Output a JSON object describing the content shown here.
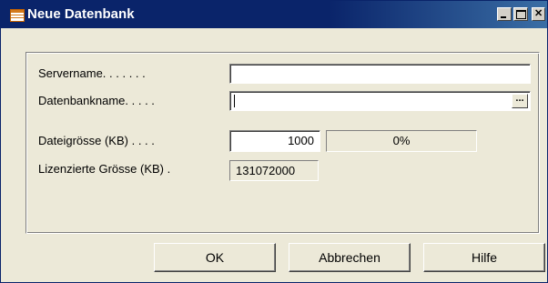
{
  "window": {
    "title": "Neue Datenbank",
    "icon": "database-window-icon",
    "controls": [
      "minimize",
      "maximize",
      "close"
    ]
  },
  "form": {
    "server_label": "Servername. . . . . . .",
    "server_value": "",
    "database_label": "Datenbankname. . . . .",
    "database_value": "",
    "lookup_button": "...",
    "filesize_label": "Dateigrösse (KB) . . . .",
    "filesize_value": "1000",
    "progress_text": "0%",
    "progress_fraction": 0,
    "license_label": "Lizenzierte Grösse (KB) .",
    "license_value": "131072000"
  },
  "buttons": {
    "ok": "OK",
    "cancel": "Abbrechen",
    "help": "Hilfe"
  }
}
